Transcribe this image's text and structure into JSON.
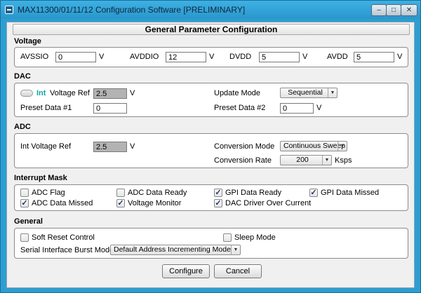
{
  "window": {
    "title": "MAX11300/01/11/12 Configuration Software [PRELIMINARY]",
    "accent_color": "#2d9ed1"
  },
  "header": {
    "title": "General Parameter Configuration"
  },
  "voltage": {
    "section_title": "Voltage",
    "fields": [
      {
        "label": "AVSSIO",
        "value": "0",
        "unit": "V"
      },
      {
        "label": "AVDDIO",
        "value": "12",
        "unit": "V"
      },
      {
        "label": "DVDD",
        "value": "5",
        "unit": "V"
      },
      {
        "label": "AVDD",
        "value": "5",
        "unit": "V"
      }
    ]
  },
  "dac": {
    "section_title": "DAC",
    "int_label": "Int",
    "voltage_ref_label": "Voltage Ref",
    "voltage_ref_value": "2.5",
    "voltage_ref_unit": "V",
    "update_mode_label": "Update Mode",
    "update_mode_value": "Sequential",
    "preset1_label": "Preset Data #1",
    "preset1_value": "0",
    "preset2_label": "Preset Data #2",
    "preset2_value": "0",
    "preset2_unit": "V"
  },
  "adc": {
    "section_title": "ADC",
    "voltage_ref_label": "Int Voltage Ref",
    "voltage_ref_value": "2.5",
    "voltage_ref_unit": "V",
    "conversion_mode_label": "Conversion Mode",
    "conversion_mode_value": "Continuous Sweep",
    "conversion_rate_label": "Conversion Rate",
    "conversion_rate_value": "200",
    "conversion_rate_unit": "Ksps"
  },
  "interrupt_mask": {
    "section_title": "Interrupt Mask",
    "items": [
      {
        "label": "ADC Flag",
        "checked": false
      },
      {
        "label": "ADC Data Ready",
        "checked": false
      },
      {
        "label": "GPI Data Ready",
        "checked": true
      },
      {
        "label": "GPI Data Missed",
        "checked": true
      },
      {
        "label": "ADC Data Missed",
        "checked": true
      },
      {
        "label": "Voltage Monitor",
        "checked": true
      },
      {
        "label": "DAC Driver Over Current",
        "checked": true
      }
    ]
  },
  "general": {
    "section_title": "General",
    "soft_reset_label": "Soft Reset Control",
    "soft_reset_checked": false,
    "sleep_mode_label": "Sleep Mode",
    "sleep_mode_checked": false,
    "burst_mode_label": "Serial Interface Burst Mode",
    "burst_mode_value": "Default Address Incrementing Mode"
  },
  "buttons": {
    "configure": "Configure",
    "cancel": "Cancel"
  },
  "icons": {
    "check": "✓",
    "dropdown_arrow": "▼",
    "minimize": "–",
    "maximize": "□",
    "close": "✕"
  }
}
